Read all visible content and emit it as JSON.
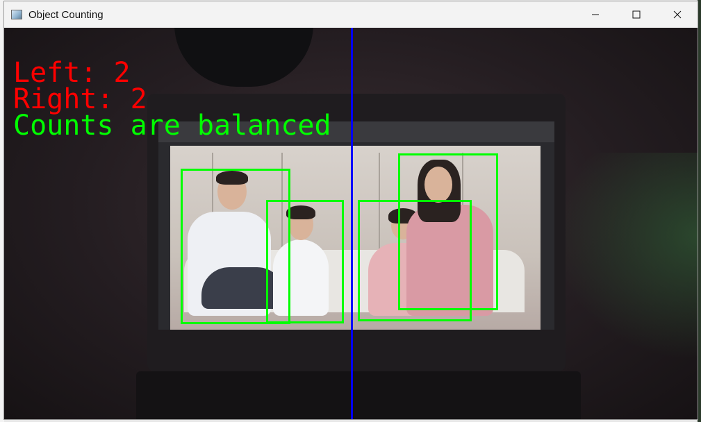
{
  "window": {
    "title": "Object Counting",
    "icon": "app-image-icon",
    "controls": {
      "minimize": "minimize-icon",
      "maximize": "maximize-icon",
      "close": "close-icon"
    }
  },
  "overlay": {
    "left_text": "Left: 2",
    "right_text": "Right: 2",
    "status_text": "Counts are balanced"
  },
  "colors": {
    "left_right_text": "#ff0000",
    "status_text": "#00ff00",
    "bounding_box": "#00ff00",
    "divider_line": "#0000ff"
  },
  "detections": {
    "count_left": 2,
    "count_right": 2,
    "total_boxes": 4
  }
}
